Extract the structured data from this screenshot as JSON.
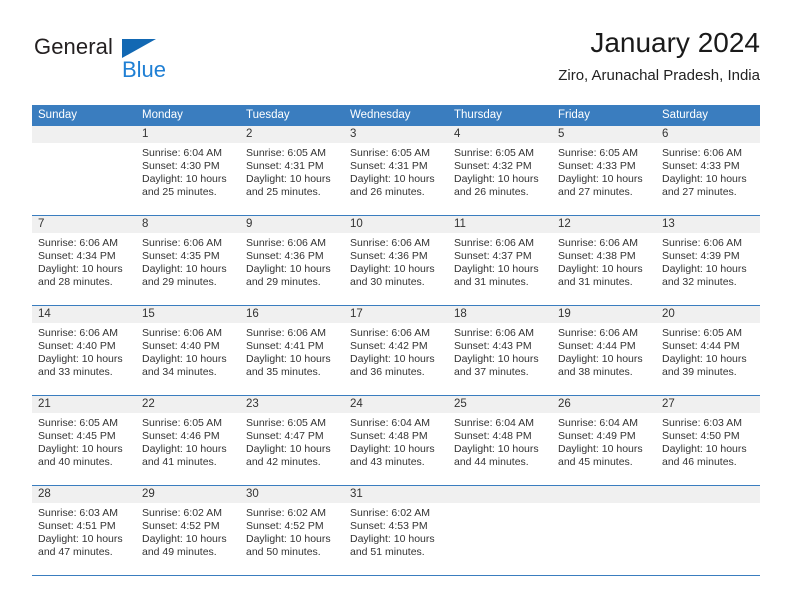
{
  "brand": {
    "name_part1": "General",
    "name_part2": "Blue",
    "triangle_color": "#1268b3",
    "blue_color": "#1f7fd4"
  },
  "header": {
    "title": "January 2024",
    "subtitle": "Ziro, Arunachal Pradesh, India"
  },
  "theme": {
    "header_blue": "#3a7dbf",
    "band_gray": "#f0f0f0"
  },
  "weekdays": [
    "Sunday",
    "Monday",
    "Tuesday",
    "Wednesday",
    "Thursday",
    "Friday",
    "Saturday"
  ],
  "labels": {
    "sunrise_prefix": "Sunrise:",
    "sunset_prefix": "Sunset:",
    "daylight_prefix": "Daylight:"
  },
  "weeks": [
    [
      {
        "day": "",
        "empty": true
      },
      {
        "day": "1",
        "sunrise": "Sunrise: 6:04 AM",
        "sunset": "Sunset: 4:30 PM",
        "daylight": "Daylight: 10 hours and 25 minutes."
      },
      {
        "day": "2",
        "sunrise": "Sunrise: 6:05 AM",
        "sunset": "Sunset: 4:31 PM",
        "daylight": "Daylight: 10 hours and 25 minutes."
      },
      {
        "day": "3",
        "sunrise": "Sunrise: 6:05 AM",
        "sunset": "Sunset: 4:31 PM",
        "daylight": "Daylight: 10 hours and 26 minutes."
      },
      {
        "day": "4",
        "sunrise": "Sunrise: 6:05 AM",
        "sunset": "Sunset: 4:32 PM",
        "daylight": "Daylight: 10 hours and 26 minutes."
      },
      {
        "day": "5",
        "sunrise": "Sunrise: 6:05 AM",
        "sunset": "Sunset: 4:33 PM",
        "daylight": "Daylight: 10 hours and 27 minutes."
      },
      {
        "day": "6",
        "sunrise": "Sunrise: 6:06 AM",
        "sunset": "Sunset: 4:33 PM",
        "daylight": "Daylight: 10 hours and 27 minutes."
      }
    ],
    [
      {
        "day": "7",
        "sunrise": "Sunrise: 6:06 AM",
        "sunset": "Sunset: 4:34 PM",
        "daylight": "Daylight: 10 hours and 28 minutes."
      },
      {
        "day": "8",
        "sunrise": "Sunrise: 6:06 AM",
        "sunset": "Sunset: 4:35 PM",
        "daylight": "Daylight: 10 hours and 29 minutes."
      },
      {
        "day": "9",
        "sunrise": "Sunrise: 6:06 AM",
        "sunset": "Sunset: 4:36 PM",
        "daylight": "Daylight: 10 hours and 29 minutes."
      },
      {
        "day": "10",
        "sunrise": "Sunrise: 6:06 AM",
        "sunset": "Sunset: 4:36 PM",
        "daylight": "Daylight: 10 hours and 30 minutes."
      },
      {
        "day": "11",
        "sunrise": "Sunrise: 6:06 AM",
        "sunset": "Sunset: 4:37 PM",
        "daylight": "Daylight: 10 hours and 31 minutes."
      },
      {
        "day": "12",
        "sunrise": "Sunrise: 6:06 AM",
        "sunset": "Sunset: 4:38 PM",
        "daylight": "Daylight: 10 hours and 31 minutes."
      },
      {
        "day": "13",
        "sunrise": "Sunrise: 6:06 AM",
        "sunset": "Sunset: 4:39 PM",
        "daylight": "Daylight: 10 hours and 32 minutes."
      }
    ],
    [
      {
        "day": "14",
        "sunrise": "Sunrise: 6:06 AM",
        "sunset": "Sunset: 4:40 PM",
        "daylight": "Daylight: 10 hours and 33 minutes."
      },
      {
        "day": "15",
        "sunrise": "Sunrise: 6:06 AM",
        "sunset": "Sunset: 4:40 PM",
        "daylight": "Daylight: 10 hours and 34 minutes."
      },
      {
        "day": "16",
        "sunrise": "Sunrise: 6:06 AM",
        "sunset": "Sunset: 4:41 PM",
        "daylight": "Daylight: 10 hours and 35 minutes."
      },
      {
        "day": "17",
        "sunrise": "Sunrise: 6:06 AM",
        "sunset": "Sunset: 4:42 PM",
        "daylight": "Daylight: 10 hours and 36 minutes."
      },
      {
        "day": "18",
        "sunrise": "Sunrise: 6:06 AM",
        "sunset": "Sunset: 4:43 PM",
        "daylight": "Daylight: 10 hours and 37 minutes."
      },
      {
        "day": "19",
        "sunrise": "Sunrise: 6:06 AM",
        "sunset": "Sunset: 4:44 PM",
        "daylight": "Daylight: 10 hours and 38 minutes."
      },
      {
        "day": "20",
        "sunrise": "Sunrise: 6:05 AM",
        "sunset": "Sunset: 4:44 PM",
        "daylight": "Daylight: 10 hours and 39 minutes."
      }
    ],
    [
      {
        "day": "21",
        "sunrise": "Sunrise: 6:05 AM",
        "sunset": "Sunset: 4:45 PM",
        "daylight": "Daylight: 10 hours and 40 minutes."
      },
      {
        "day": "22",
        "sunrise": "Sunrise: 6:05 AM",
        "sunset": "Sunset: 4:46 PM",
        "daylight": "Daylight: 10 hours and 41 minutes."
      },
      {
        "day": "23",
        "sunrise": "Sunrise: 6:05 AM",
        "sunset": "Sunset: 4:47 PM",
        "daylight": "Daylight: 10 hours and 42 minutes."
      },
      {
        "day": "24",
        "sunrise": "Sunrise: 6:04 AM",
        "sunset": "Sunset: 4:48 PM",
        "daylight": "Daylight: 10 hours and 43 minutes."
      },
      {
        "day": "25",
        "sunrise": "Sunrise: 6:04 AM",
        "sunset": "Sunset: 4:48 PM",
        "daylight": "Daylight: 10 hours and 44 minutes."
      },
      {
        "day": "26",
        "sunrise": "Sunrise: 6:04 AM",
        "sunset": "Sunset: 4:49 PM",
        "daylight": "Daylight: 10 hours and 45 minutes."
      },
      {
        "day": "27",
        "sunrise": "Sunrise: 6:03 AM",
        "sunset": "Sunset: 4:50 PM",
        "daylight": "Daylight: 10 hours and 46 minutes."
      }
    ],
    [
      {
        "day": "28",
        "sunrise": "Sunrise: 6:03 AM",
        "sunset": "Sunset: 4:51 PM",
        "daylight": "Daylight: 10 hours and 47 minutes."
      },
      {
        "day": "29",
        "sunrise": "Sunrise: 6:02 AM",
        "sunset": "Sunset: 4:52 PM",
        "daylight": "Daylight: 10 hours and 49 minutes."
      },
      {
        "day": "30",
        "sunrise": "Sunrise: 6:02 AM",
        "sunset": "Sunset: 4:52 PM",
        "daylight": "Daylight: 10 hours and 50 minutes."
      },
      {
        "day": "31",
        "sunrise": "Sunrise: 6:02 AM",
        "sunset": "Sunset: 4:53 PM",
        "daylight": "Daylight: 10 hours and 51 minutes."
      },
      {
        "day": "",
        "empty": true
      },
      {
        "day": "",
        "empty": true
      },
      {
        "day": "",
        "empty": true
      }
    ]
  ]
}
